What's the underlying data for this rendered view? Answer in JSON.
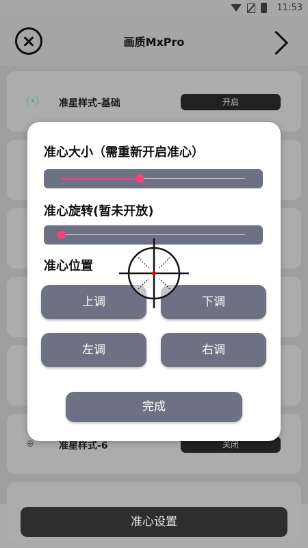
{
  "status_bar": {
    "time": "11:53",
    "icons": [
      "wifi-icon",
      "no-sim-icon",
      "battery-icon"
    ]
  },
  "header": {
    "title": "画质MxPro",
    "close_icon": "close-circle-icon",
    "next_icon": "chevron-right-icon"
  },
  "list_items": [
    {
      "icon": "bracket-dot-icon",
      "icon_glyph": "(•)",
      "label": "准星样式-基础",
      "toggle": "开启"
    },
    {
      "icon": "crosshair-icon",
      "icon_glyph": "⊕",
      "label": "准星样式-6",
      "toggle": "关闭"
    }
  ],
  "dialog": {
    "size_title": "准心大小（需重新开启准心）",
    "size_value": 0.43,
    "rotation_title": "准心旋转(暂未开放)",
    "rotation_value": 0.0,
    "position_title": "准心位置",
    "buttons": {
      "up": "上调",
      "down": "下调",
      "left": "左调",
      "right": "右调"
    },
    "done": "完成"
  },
  "bottom": {
    "label": "准心设置"
  },
  "colors": {
    "accent": "#ff3f7b",
    "button": "#6e7183",
    "dark": "#2e2e2e"
  }
}
